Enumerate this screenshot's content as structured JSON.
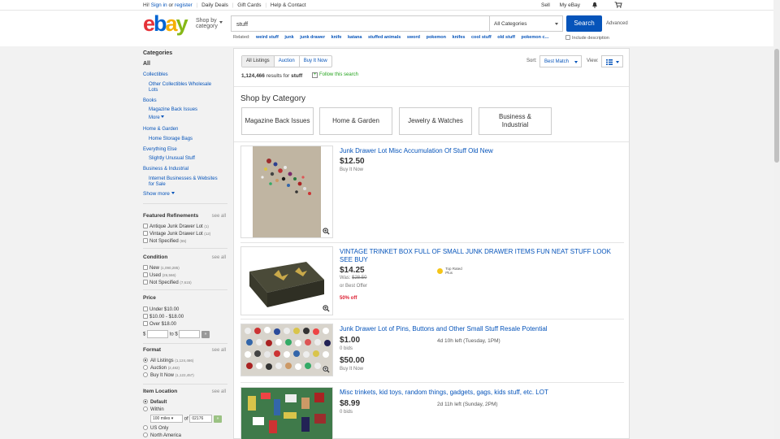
{
  "topbar": {
    "greeting": "Hi!",
    "sign_in": "Sign in",
    "or": "or",
    "register": "register",
    "daily_deals": "Daily Deals",
    "gift_cards": "Gift Cards",
    "help": "Help & Contact",
    "sell": "Sell",
    "my_ebay": "My eBay"
  },
  "header": {
    "logo": {
      "e": "e",
      "b": "b",
      "a": "a",
      "y": "y"
    },
    "shop_by_category": "Shop by category",
    "search_value": "stuff",
    "category_select": "All Categories",
    "search_button": "Search",
    "advanced": "Advanced",
    "related_label": "Related:",
    "related": [
      "weird stuff",
      "junk",
      "junk drawer",
      "knife",
      "katana",
      "stuffed animals",
      "sword",
      "pokemon",
      "knifes",
      "cool stuff",
      "old stuff",
      "pokemon c..."
    ],
    "include_description": "Include description"
  },
  "sidebar": {
    "categories_title": "Categories",
    "all": "All",
    "cats": [
      "Collectibles",
      "Other Collectibles Wholesale",
      "Lots",
      "Books",
      "Magazine Back Issues",
      "More",
      "Home & Garden",
      "Home Storage Bags",
      "Everything Else",
      "Slightly Unusual Stuff",
      "Business & Industrial",
      "Internet Businesses & Websites",
      "for Sale",
      "Show more"
    ],
    "featured": {
      "title": "Featured Refinements",
      "see_all": "see all",
      "items": [
        {
          "label": "Antique Junk Drawer Lot",
          "count": "(1)"
        },
        {
          "label": "Vintage Junk Drawer Lot",
          "count": "(12)"
        },
        {
          "label": "Not Specified",
          "count": "(65)"
        }
      ]
    },
    "condition": {
      "title": "Condition",
      "see_all": "see all",
      "items": [
        {
          "label": "New",
          "count": "(1,090,285)"
        },
        {
          "label": "Used",
          "count": "(26,566)"
        },
        {
          "label": "Not Specified",
          "count": "(7,615)"
        }
      ]
    },
    "price": {
      "title": "Price",
      "items": [
        "Under $10.00",
        "$10.00 - $18.00",
        "Over $18.00"
      ],
      "dollar": "$",
      "to": "to",
      "go": "»"
    },
    "format": {
      "title": "Format",
      "see_all": "see all",
      "items": [
        {
          "label": "All Listings",
          "count": "(1,124,466)"
        },
        {
          "label": "Auction",
          "count": "(2,482)"
        },
        {
          "label": "Buy It Now",
          "count": "(1,122,457)"
        }
      ]
    },
    "location": {
      "title": "Item Location",
      "see_all": "see all",
      "default": "Default",
      "within": "Within",
      "miles": "100 miles",
      "of": "of",
      "zip": "02176",
      "us_only": "US Only",
      "north_america": "North America"
    }
  },
  "main": {
    "tabs": [
      "All Listings",
      "Auction",
      "Buy It Now"
    ],
    "results_count": "1,124,466",
    "results_text": "results for",
    "results_query": "stuff",
    "follow": "Follow this search",
    "sort_label": "Sort:",
    "sort_value": "Best Match",
    "view_label": "View:",
    "shop_by_category": "Shop by Category",
    "category_boxes": [
      "Magazine Back Issues",
      "Home & Garden",
      "Jewelry & Watches",
      "Business & Industrial"
    ],
    "listings": [
      {
        "title": "Junk Drawer Lot Misc Accumulation Of Stuff Old New",
        "price": "$12.50",
        "format": "Buy It Now"
      },
      {
        "title": "VINTAGE TRINKET BOX FULL OF SMALL JUNK DRAWER ITEMS FUN NEAT STUFF LOOK SEE BUY",
        "price": "$14.25",
        "was_label": "Was:",
        "was_price": "$28.50",
        "best_offer": "or Best Offer",
        "off": "50% off",
        "top_rated": "Top Rated",
        "top_rated_plus": "Plus"
      },
      {
        "title": "Junk Drawer Lot of Pins, Buttons and Other Small Stuff Resale Potential",
        "price": "$1.00",
        "bids": "0 bids",
        "time_left": "4d 10h left (Tuesday, 1PM)",
        "price2": "$50.00",
        "format2": "Buy It Now"
      },
      {
        "title": "Misc trinkets, kid toys, random things, gadgets, gags, kids stuff, etc. LOT",
        "price": "$8.99",
        "bids": "0 bids",
        "time_left": "2d 11h left (Sunday, 2PM)"
      }
    ]
  },
  "colors": {
    "link": "#0654ba",
    "search_button": "#0654ba",
    "discount": "#dd1e31",
    "follow": "#23a31c"
  },
  "icons": [
    "bell-icon",
    "cart-icon",
    "zoom-icon",
    "plus-icon",
    "list-view-icon",
    "top-rated-icon"
  ]
}
